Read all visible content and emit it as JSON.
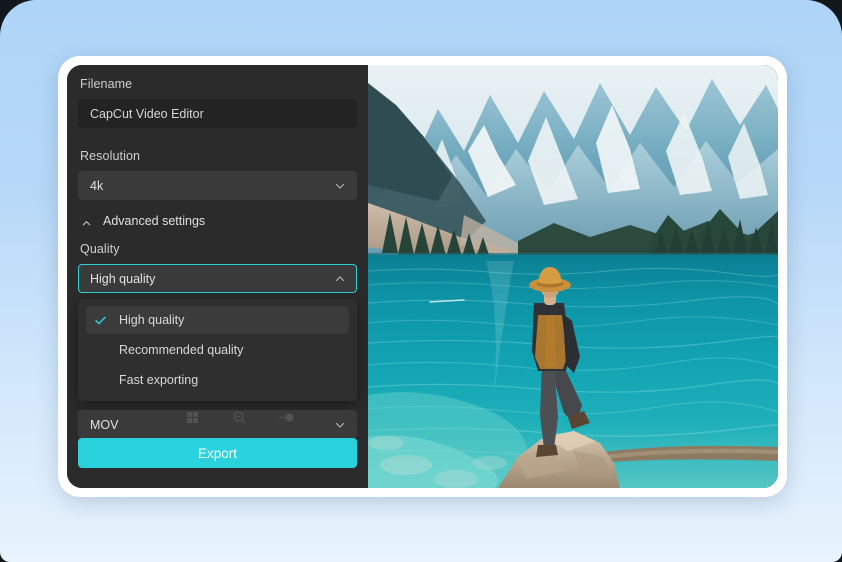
{
  "window": {
    "panel_bg": "#2b2b2b",
    "accent": "#2ad2dd",
    "backdrop_top": "#aed4f7",
    "backdrop_bottom": "#e8f3fd"
  },
  "settings": {
    "filename": {
      "label": "Filename",
      "value": "CapCut Video Editor"
    },
    "resolution": {
      "label": "Resolution",
      "value": "4k",
      "chevron_icon": "chevron-down-icon"
    },
    "advanced": {
      "label": "Advanced settings",
      "caret_icon": "chevron-up-icon",
      "expanded": true
    },
    "quality": {
      "label": "Quality",
      "value": "High quality",
      "chevron_icon": "chevron-up-icon",
      "open": true,
      "options": [
        {
          "label": "High quality",
          "selected": true,
          "check_icon": "check-icon"
        },
        {
          "label": "Recommended quality",
          "selected": false,
          "check_icon": "check-icon"
        },
        {
          "label": "Fast exporting",
          "selected": false,
          "check_icon": "check-icon"
        }
      ]
    },
    "format": {
      "value": "MOV",
      "chevron_icon": "chevron-down-icon"
    },
    "ghost_controls": [
      {
        "icon": "grid-icon"
      },
      {
        "icon": "zoom-out-icon"
      },
      {
        "icon": "toggle-icon"
      }
    ],
    "export_button": {
      "label": "Export",
      "color": "#2ad2dd"
    }
  },
  "preview": {
    "alt": "Moraine Lake mountain panorama with a person in a hat standing on a rock by turquoise water",
    "sky_color": "#dce8ee",
    "water_color": "#0e8fa0",
    "mountain_color": "#7fb3c4",
    "forest_color": "#2c4a3c",
    "rock_color": "#c3ab93"
  }
}
